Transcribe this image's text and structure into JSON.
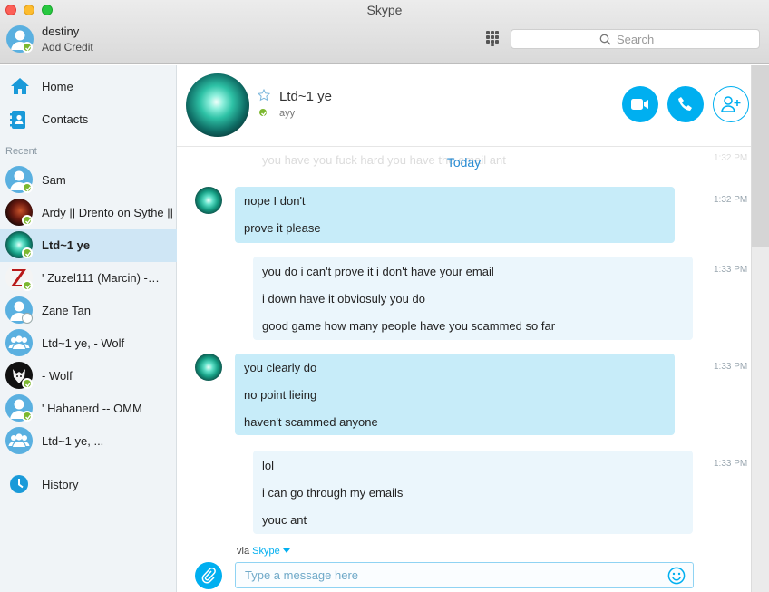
{
  "window": {
    "title": "Skype"
  },
  "me": {
    "name": "destiny",
    "credit_link": "Add Credit",
    "status": "online"
  },
  "search": {
    "placeholder": "Search"
  },
  "nav": [
    {
      "label": "Home",
      "icon": "home-icon"
    },
    {
      "label": "Contacts",
      "icon": "contacts-icon"
    }
  ],
  "recent_header": "Recent",
  "contacts": [
    {
      "name": "Sam",
      "avatar": "person",
      "status": "online"
    },
    {
      "name": "Ardy || Drento on Sythe ||",
      "avatar": "photo-red",
      "status": "online"
    },
    {
      "name": "Ltd~1 ye",
      "avatar": "photo-teal",
      "status": "online",
      "selected": true
    },
    {
      "name": "' Zuzel111 (Marcin) -…",
      "avatar": "photo-z",
      "status": "online"
    },
    {
      "name": "Zane Tan",
      "avatar": "person",
      "status": "offline"
    },
    {
      "name": "Ltd~1 ye, - Wolf",
      "avatar": "group",
      "status": "none"
    },
    {
      "name": "- Wolf",
      "avatar": "photo-wolf",
      "status": "online"
    },
    {
      "name": "' Hahanerd -- OMM",
      "avatar": "person",
      "status": "online"
    },
    {
      "name": "Ltd~1 ye, ...",
      "avatar": "group",
      "status": "none"
    }
  ],
  "history": {
    "label": "History"
  },
  "chat": {
    "name": "Ltd~1 ye",
    "mood": "ayy",
    "ghost_line": "you have you fuck hard you have the email     ant",
    "ghost_time": "1:32 PM",
    "day_label": "Today",
    "groups": [
      {
        "from": "them",
        "time": "1:32 PM",
        "lines": [
          "nope I don't",
          "prove it please"
        ]
      },
      {
        "from": "me",
        "time": "1:33 PM",
        "lines": [
          "you do i can't prove it i don't have your email",
          "i down have it obviosuly you do",
          "good game how many people have you scammed so far"
        ]
      },
      {
        "from": "them",
        "time": "1:33 PM",
        "lines": [
          "you clearly do",
          "no point lieing",
          "haven't scammed anyone"
        ]
      },
      {
        "from": "me",
        "time": "1:33 PM",
        "lines": [
          "lol",
          "i can go through my emails",
          "youc ant"
        ]
      }
    ]
  },
  "composer": {
    "via_prefix": "via",
    "via_service": "Skype",
    "placeholder": "Type a message here"
  },
  "colors": {
    "accent": "#00aff0",
    "incoming_bubble": "#c7ecf9",
    "outgoing_bubble": "#ebf6fc",
    "online": "#7cb82f"
  }
}
